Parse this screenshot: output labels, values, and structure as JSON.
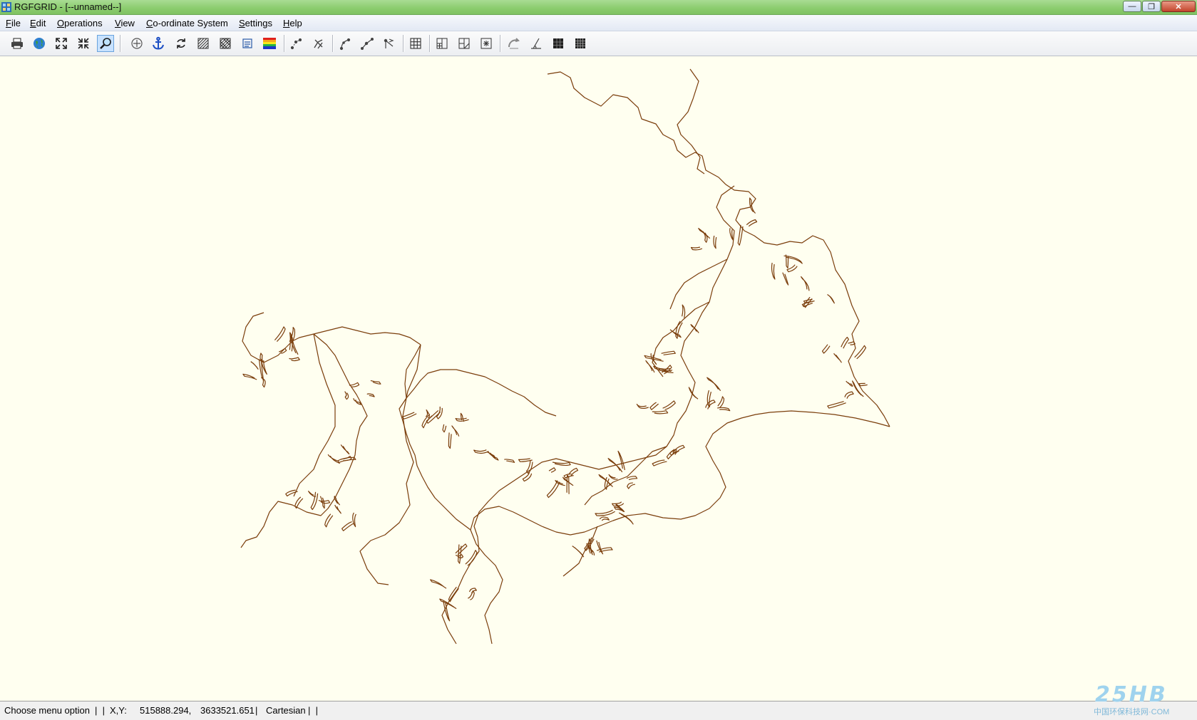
{
  "window": {
    "title": "RGFGRID - [--unnamed--]",
    "controls": [
      "minimize-icon",
      "restore-icon",
      "close-icon"
    ]
  },
  "menu": [
    "File",
    "Edit",
    "Operations",
    "View",
    "Co-ordinate System",
    "Settings",
    "Help"
  ],
  "toolbar": {
    "groups": [
      [
        "print-icon",
        "globe-icon",
        "zoom-extent-icon",
        "zoom-fit-icon",
        "zoom-box-icon"
      ],
      [
        "center-icon",
        "anchor-icon",
        "refresh-icon",
        "grid-pattern-icon",
        "grid-dense-icon",
        "list-icon",
        "color-scale-icon"
      ],
      [
        "polyline-points-icon",
        "delete-polyline-icon"
      ],
      [
        "spline-add-icon",
        "spline-insert-icon",
        "spline-move-icon"
      ],
      [
        "grid-icon"
      ],
      [
        "grid-refine-icon",
        "grid-derefine-icon",
        "grid-move-icon"
      ],
      [
        "orthogonalize-icon",
        "angle-icon",
        "block-icon",
        "block-grid-icon"
      ]
    ],
    "active_tool": "zoom-box-icon"
  },
  "canvas": {
    "background": "#fffff0",
    "outline_color": "#7a3d0b"
  },
  "status": {
    "message": "Choose menu option",
    "coord_label": "X,Y:",
    "x": "515888.294,",
    "y": "3633521.651",
    "system": "Cartesian"
  },
  "watermark": {
    "logo": "25HB",
    "text": "中国环保科技网·COM"
  }
}
